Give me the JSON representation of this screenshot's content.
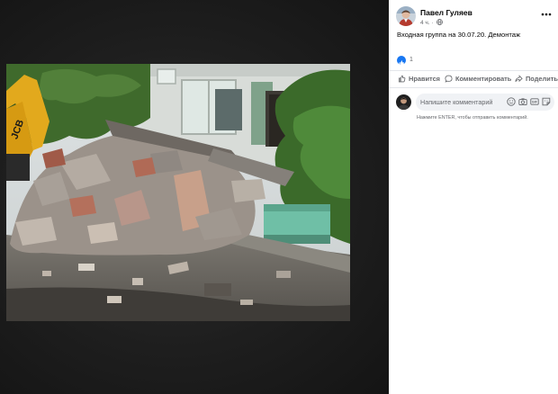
{
  "post": {
    "author": "Павел Гуляев",
    "time": "4 ч.",
    "caption": "Входная группа на 30.07.20. Демонтаж"
  },
  "reactions": {
    "count": "1"
  },
  "actions": {
    "like": "Нравится",
    "comment": "Комментировать",
    "share": "Поделиться"
  },
  "comment_box": {
    "placeholder": "Напишите комментарий...",
    "hint": "Нажмите ENTER, чтобы отправить комментарий."
  },
  "colors": {
    "accent": "#1877f2",
    "viewer_bg": "#1c1c1c",
    "panel_bg": "#ffffff",
    "secondary_text": "#65676b"
  }
}
